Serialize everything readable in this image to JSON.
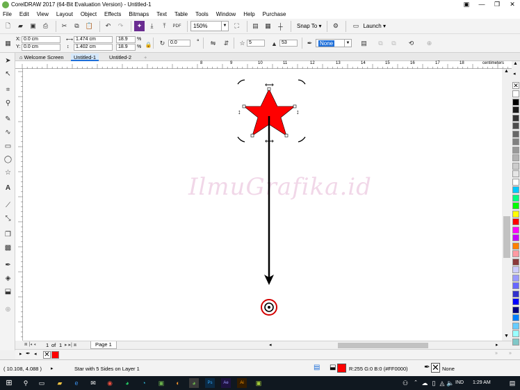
{
  "window": {
    "title": "CorelDRAW 2017 (64-Bit Evaluation Version) - Untitled-1",
    "controls": {
      "help": "▣",
      "minimize": "—",
      "restore": "❐",
      "close": "✕"
    }
  },
  "menu": [
    "File",
    "Edit",
    "View",
    "Layout",
    "Object",
    "Effects",
    "Bitmaps",
    "Text",
    "Table",
    "Tools",
    "Window",
    "Help",
    "Purchase"
  ],
  "toolbar": {
    "zoom": "150%",
    "snap_to": "Snap To",
    "launch": "Launch"
  },
  "propbar": {
    "x_label": "X:",
    "x_value": "0.0 cm",
    "y_label": "Y:",
    "y_value": "0.0 cm",
    "width_value": "1.474 cm",
    "height_value": "1.402 cm",
    "scale_x": "18.9",
    "scale_y": "18.9",
    "percent": "%",
    "angle_value": "0.0",
    "angle_unit": "°",
    "points_value": "5",
    "sharpness_value": "53",
    "outline_value": "None"
  },
  "doc_tabs": [
    "Welcome Screen",
    "Untitled-1",
    "Untitled-2"
  ],
  "ruler": {
    "h_ticks": [
      "8",
      "9",
      "10",
      "11",
      "12",
      "13",
      "14",
      "15",
      "16",
      "17",
      "18"
    ],
    "unit": "centimeters"
  },
  "watermark": "IlmuGrafika.id",
  "page_nav": {
    "current": "1",
    "of": "of",
    "total": "1",
    "page_tab": "Page 1"
  },
  "status": {
    "coords": "( 10.108, 4.088 )",
    "object_info": "Star with 5 Sides on Layer 1",
    "fill_info": "R:255 G:0 B:0 (#FF0000)",
    "outline_info": "None"
  },
  "taskbar": {
    "lang": "IND",
    "time": "1:29 AM"
  },
  "colors": {
    "star_fill": "#FF0000",
    "accent_blue": "#1e6fd9",
    "taskbar": "#101820"
  },
  "palette": [
    "#ffffff",
    "#000000",
    "#1a1a1a",
    "#333333",
    "#4d4d4d",
    "#666666",
    "#808080",
    "#999999",
    "#b3b3b3",
    "#cccccc",
    "#e6e6e6",
    "#ffffff",
    "#00c8ff",
    "#00ff80",
    "#00ff00",
    "#ffff00",
    "#ff0000",
    "#ff00ff",
    "#c800ff",
    "#ff8000",
    "#ff9aa2",
    "#8b3a3a",
    "#ccccff",
    "#9999ff",
    "#6666ff",
    "#3333cc",
    "#0000ff",
    "#000080",
    "#0080ff",
    "#66ccff",
    "#99ffff",
    "#80c8c8"
  ]
}
